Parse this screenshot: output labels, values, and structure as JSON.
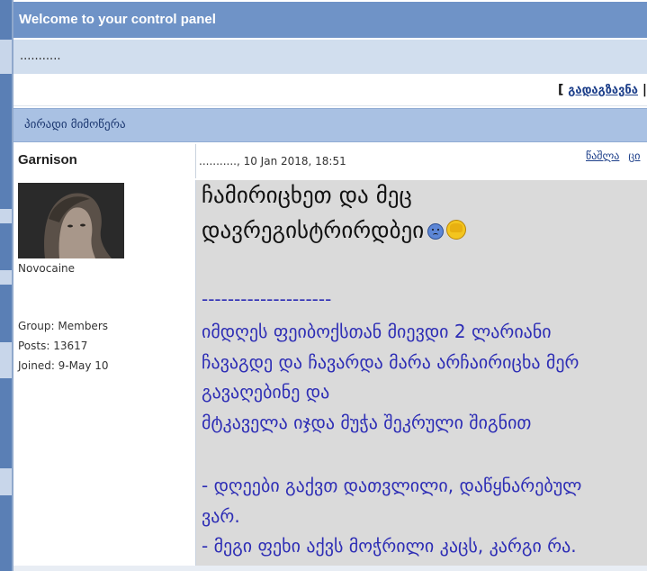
{
  "header": {
    "welcome": "Welcome to your control panel"
  },
  "subheader": {
    "dots": "..........."
  },
  "actions": {
    "open_bracket": "[",
    "forward_label": "გადაგზავნა",
    "separator": "|"
  },
  "section": {
    "title": "პირადი მიმოწერა"
  },
  "post": {
    "author": "Garnison",
    "date": "..........., 10 Jan 2018, 18:51",
    "links": [
      "წაშლა",
      "ცი"
    ],
    "author_title": "Novocaine",
    "group": "Group: Members",
    "posts": "Posts: 13617",
    "joined": "Joined: 9-May 10",
    "big_lines": [
      "ჩამირიცხეთ და მეც",
      "დავრეგისტრირდბეი"
    ],
    "divider": "--------------------",
    "blue_lines": [
      "იმდღეს ფეიბოქსთან მიევდი 2 ლარიანი",
      "ჩავაგდე და ჩავარდა მარა არჩაირიცხა მერ",
      "გავაღებინე და",
      "მტკაველა იჯდა მუჭა შეკრული შიგნით",
      "",
      "- დღეები გაქვთ დათვლილი, დაწყნარებულ",
      "ვარ.",
      "- მეგი ფეხი აქვს მოჭრილი კაცს, კარგი რა."
    ],
    "emoji_icons": [
      "sad-face-icon",
      "facepalm-icon"
    ]
  }
}
